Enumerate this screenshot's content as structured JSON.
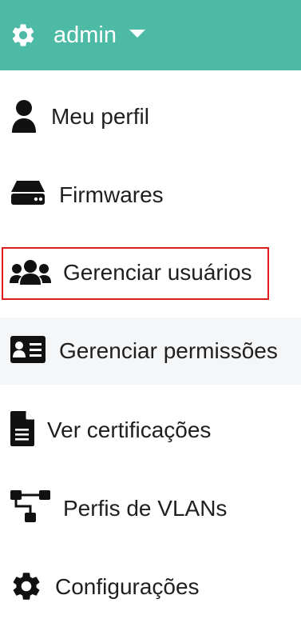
{
  "header": {
    "username": "admin",
    "settings_icon": "gear-icon",
    "dropdown_icon": "caret-down-icon",
    "background_color": "#4dbaa6"
  },
  "menu": {
    "items": [
      {
        "label": "Meu perfil",
        "icon": "user-icon"
      },
      {
        "label": "Firmwares",
        "icon": "hard-drive-icon"
      },
      {
        "label": "Gerenciar usuários",
        "icon": "users-icon",
        "selected": true
      },
      {
        "label": "Gerenciar permissões",
        "icon": "id-card-icon",
        "hovered": true
      },
      {
        "label": "Ver certificações",
        "icon": "file-icon"
      },
      {
        "label": "Perfis de VLANs",
        "icon": "sitemap-icon"
      },
      {
        "label": "Configurações",
        "icon": "gear-icon"
      }
    ],
    "selection_color": "#e11a1a",
    "hover_color": "#f5f6f8"
  }
}
